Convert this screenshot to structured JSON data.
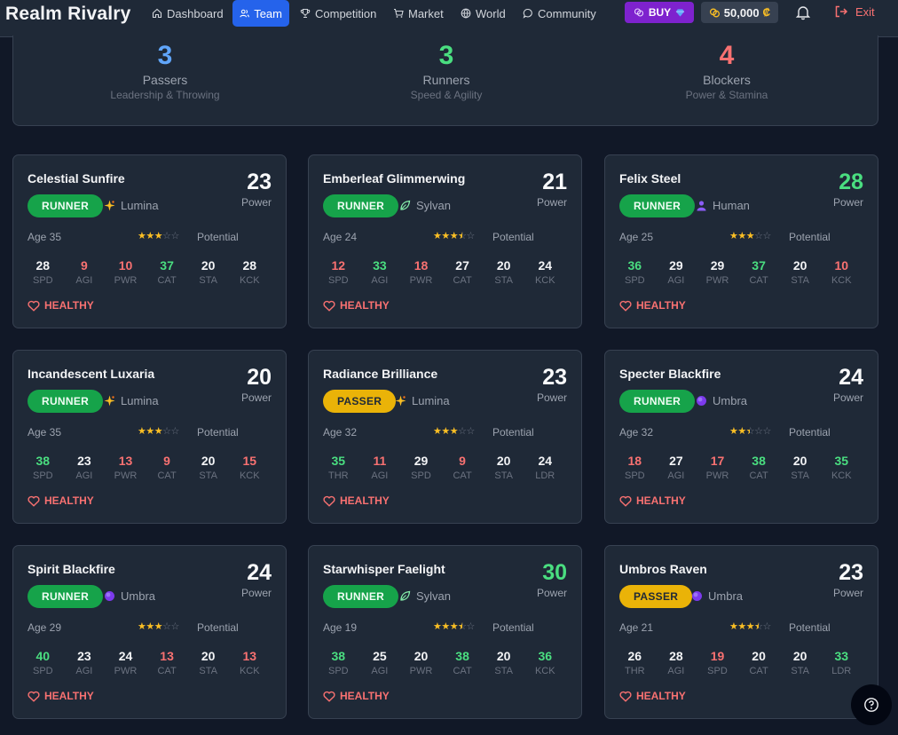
{
  "app": {
    "title": "Realm Rivalry"
  },
  "nav": {
    "items": [
      {
        "label": "Dashboard",
        "icon": "home-icon"
      },
      {
        "label": "Team",
        "icon": "users-icon"
      },
      {
        "label": "Competition",
        "icon": "trophy-icon"
      },
      {
        "label": "Market",
        "icon": "cart-icon"
      },
      {
        "label": "World",
        "icon": "globe-icon"
      },
      {
        "label": "Community",
        "icon": "chat-icon"
      }
    ],
    "active": "Team",
    "buy_label": "BUY",
    "coins": "50,000",
    "exit_label": "Exit"
  },
  "summary": [
    {
      "count": "3",
      "label": "Passers",
      "sub": "Leadership & Throwing",
      "color": "#60a5fa"
    },
    {
      "count": "3",
      "label": "Runners",
      "sub": "Speed & Agility",
      "color": "#4ade80"
    },
    {
      "count": "4",
      "label": "Blockers",
      "sub": "Power & Stamina",
      "color": "#f87171"
    }
  ],
  "colors": {
    "accent": "#2563eb",
    "good": "#4ade80",
    "bad": "#f87171",
    "runner": "#16a34a",
    "passer": "#eab308",
    "buy": "#7e22ce"
  },
  "players": [
    {
      "name": "Celestial Sunfire",
      "power": "23",
      "role": "RUNNER",
      "race": "Lumina",
      "age": "Age 35",
      "stars": 3,
      "potential_label": "Potential",
      "status": "HEALTHY",
      "stats": [
        {
          "v": "28",
          "n": "SPD"
        },
        {
          "v": "9",
          "n": "AGI"
        },
        {
          "v": "10",
          "n": "PWR"
        },
        {
          "v": "37",
          "n": "CAT"
        },
        {
          "v": "20",
          "n": "STA"
        },
        {
          "v": "28",
          "n": "KCK"
        }
      ]
    },
    {
      "name": "Emberleaf Glimmerwing",
      "power": "21",
      "role": "RUNNER",
      "race": "Sylvan",
      "age": "Age 24",
      "stars": 3.5,
      "potential_label": "Potential",
      "status": "HEALTHY",
      "stats": [
        {
          "v": "12",
          "n": "SPD"
        },
        {
          "v": "33",
          "n": "AGI"
        },
        {
          "v": "18",
          "n": "PWR"
        },
        {
          "v": "27",
          "n": "CAT"
        },
        {
          "v": "20",
          "n": "STA"
        },
        {
          "v": "24",
          "n": "KCK"
        }
      ]
    },
    {
      "name": "Felix Steel",
      "power": "28",
      "role": "RUNNER",
      "race": "Human",
      "age": "Age 25",
      "stars": 3,
      "potential_label": "Potential",
      "status": "HEALTHY",
      "stats": [
        {
          "v": "36",
          "n": "SPD"
        },
        {
          "v": "29",
          "n": "AGI"
        },
        {
          "v": "29",
          "n": "PWR"
        },
        {
          "v": "37",
          "n": "CAT"
        },
        {
          "v": "20",
          "n": "STA"
        },
        {
          "v": "10",
          "n": "KCK"
        }
      ]
    },
    {
      "name": "Incandescent Luxaria",
      "power": "20",
      "role": "RUNNER",
      "race": "Lumina",
      "age": "Age 35",
      "stars": 3,
      "potential_label": "Potential",
      "status": "HEALTHY",
      "stats": [
        {
          "v": "38",
          "n": "SPD"
        },
        {
          "v": "23",
          "n": "AGI"
        },
        {
          "v": "13",
          "n": "PWR"
        },
        {
          "v": "9",
          "n": "CAT"
        },
        {
          "v": "20",
          "n": "STA"
        },
        {
          "v": "15",
          "n": "KCK"
        }
      ]
    },
    {
      "name": "Radiance Brilliance",
      "power": "23",
      "role": "PASSER",
      "race": "Lumina",
      "age": "Age 32",
      "stars": 3,
      "potential_label": "Potential",
      "status": "HEALTHY",
      "stats": [
        {
          "v": "35",
          "n": "THR"
        },
        {
          "v": "11",
          "n": "AGI"
        },
        {
          "v": "29",
          "n": "SPD"
        },
        {
          "v": "9",
          "n": "CAT"
        },
        {
          "v": "20",
          "n": "STA"
        },
        {
          "v": "24",
          "n": "LDR"
        }
      ]
    },
    {
      "name": "Specter Blackfire",
      "power": "24",
      "role": "RUNNER",
      "race": "Umbra",
      "age": "Age 32",
      "stars": 2.5,
      "potential_label": "Potential",
      "status": "HEALTHY",
      "stats": [
        {
          "v": "18",
          "n": "SPD"
        },
        {
          "v": "27",
          "n": "AGI"
        },
        {
          "v": "17",
          "n": "PWR"
        },
        {
          "v": "38",
          "n": "CAT"
        },
        {
          "v": "20",
          "n": "STA"
        },
        {
          "v": "35",
          "n": "KCK"
        }
      ]
    },
    {
      "name": "Spirit Blackfire",
      "power": "24",
      "role": "RUNNER",
      "race": "Umbra",
      "age": "Age 29",
      "stars": 3,
      "potential_label": "Potential",
      "status": "HEALTHY",
      "stats": [
        {
          "v": "40",
          "n": "SPD"
        },
        {
          "v": "23",
          "n": "AGI"
        },
        {
          "v": "24",
          "n": "PWR"
        },
        {
          "v": "13",
          "n": "CAT"
        },
        {
          "v": "20",
          "n": "STA"
        },
        {
          "v": "13",
          "n": "KCK"
        }
      ]
    },
    {
      "name": "Starwhisper Faelight",
      "power": "30",
      "role": "RUNNER",
      "race": "Sylvan",
      "age": "Age 19",
      "stars": 3.5,
      "potential_label": "Potential",
      "status": "HEALTHY",
      "stats": [
        {
          "v": "38",
          "n": "SPD"
        },
        {
          "v": "25",
          "n": "AGI"
        },
        {
          "v": "20",
          "n": "PWR"
        },
        {
          "v": "38",
          "n": "CAT"
        },
        {
          "v": "20",
          "n": "STA"
        },
        {
          "v": "36",
          "n": "KCK"
        }
      ]
    },
    {
      "name": "Umbros Raven",
      "power": "23",
      "role": "PASSER",
      "race": "Umbra",
      "age": "Age 21",
      "stars": 3.5,
      "potential_label": "Potential",
      "status": "HEALTHY",
      "stats": [
        {
          "v": "26",
          "n": "THR"
        },
        {
          "v": "28",
          "n": "AGI"
        },
        {
          "v": "19",
          "n": "SPD"
        },
        {
          "v": "20",
          "n": "CAT"
        },
        {
          "v": "20",
          "n": "STA"
        },
        {
          "v": "33",
          "n": "LDR"
        }
      ]
    }
  ]
}
